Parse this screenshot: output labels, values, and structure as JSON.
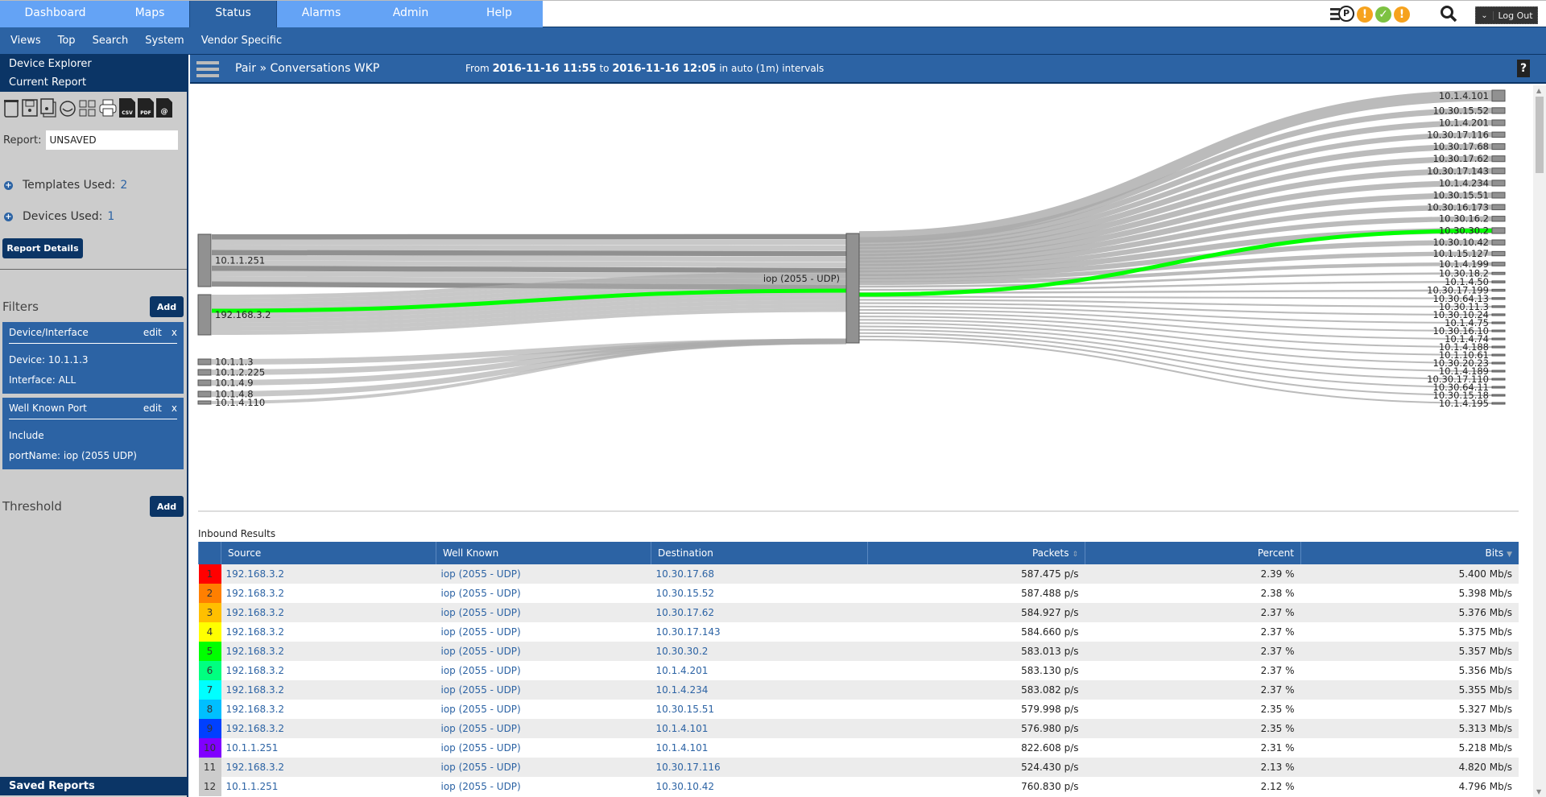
{
  "topnav": {
    "tabs": [
      {
        "label": "Dashboard",
        "active": false
      },
      {
        "label": "Maps",
        "active": false
      },
      {
        "label": "Status",
        "active": true
      },
      {
        "label": "Alarms",
        "active": false
      },
      {
        "label": "Admin",
        "active": false
      },
      {
        "label": "Help",
        "active": false
      }
    ],
    "status_icons": [
      "ep-p-icon",
      "warning-icon",
      "ok-check-icon",
      "warning-icon"
    ],
    "logout_label": "Log Out"
  },
  "subnav": {
    "items": [
      "Views",
      "Top",
      "Search",
      "System",
      "Vendor Specific"
    ]
  },
  "sidebar": {
    "device_explorer": "Device Explorer",
    "current_report": "Current Report",
    "toolbar_icons": [
      "trash-icon",
      "save-icon",
      "save-as-icon",
      "clock-icon",
      "grid-icon",
      "print-icon",
      "csv-icon",
      "pdf-icon",
      "email-icon"
    ],
    "csv": "CSV",
    "pdf": "PDF",
    "at": "@",
    "report_label": "Report:",
    "report_value": "UNSAVED",
    "templates_label": "Templates Used:",
    "templates_count": "2",
    "devices_label": "Devices Used:",
    "devices_count": "1",
    "report_details": "Report Details",
    "filters_title": "Filters",
    "add_label": "Add",
    "filters": [
      {
        "title": "Device/Interface",
        "edit": "edit",
        "remove": "x",
        "lines": [
          "Device: 10.1.1.3",
          "Interface: ALL"
        ]
      },
      {
        "title": "Well Known Port",
        "edit": "edit",
        "remove": "x",
        "lines": [
          "Include",
          "portName: iop (2055 UDP)"
        ]
      }
    ],
    "threshold_title": "Threshold",
    "saved_reports": "Saved Reports"
  },
  "header": {
    "breadcrumb": "Pair » Conversations WKP",
    "from": "From",
    "start": "2016-11-16 11:55",
    "to": "to",
    "end": "2016-11-16 12:05",
    "interval": "in auto (1m) intervals",
    "help": "?"
  },
  "chart_data": {
    "type": "sankey",
    "highlight_color": "#00ff00",
    "sources": [
      "10.1.1.251",
      "192.168.3.2",
      "10.1.1.3",
      "10.1.2.225",
      "10.1.4.9",
      "10.1.4.8",
      "10.1.4.110"
    ],
    "source_weights": [
      36,
      28,
      2,
      2,
      2,
      2,
      1
    ],
    "middle": "iop (2055 - UDP)",
    "destinations": [
      "10.1.4.101",
      "10.30.15.52",
      "10.1.4.201",
      "10.30.17.116",
      "10.30.17.68",
      "10.30.17.62",
      "10.30.17.143",
      "10.1.4.234",
      "10.30.15.51",
      "10.30.16.173",
      "10.30.16.2",
      "10.30.30.2",
      "10.30.10.42",
      "10.1.15.127",
      "10.1.4.199",
      "10.30.18.2",
      "10.1.4.50",
      "10.30.17.199",
      "10.30.64.13",
      "10.30.11.3",
      "10.30.10.24",
      "10.1.4.75",
      "10.30.16.10",
      "10.1.4.74",
      "10.1.4.188",
      "10.1.10.61",
      "10.30.20.23",
      "10.1.4.189",
      "10.30.17.110",
      "10.30.64.11",
      "10.30.15.18",
      "10.1.4.195"
    ],
    "destination_weights": [
      4.6,
      2.39,
      2.37,
      2.13,
      2.39,
      2.37,
      2.37,
      2.37,
      2.35,
      2.2,
      2.1,
      2.37,
      2.12,
      1.8,
      1.5,
      0.9,
      0.8,
      0.8,
      0.7,
      0.7,
      0.7,
      0.6,
      0.6,
      0.6,
      0.6,
      0.5,
      0.5,
      0.5,
      0.5,
      0.5,
      0.4,
      0.4
    ],
    "highlight": {
      "source": "192.168.3.2",
      "destination": "10.30.30.2"
    }
  },
  "results": {
    "title": "Inbound Results",
    "columns": [
      "",
      "Source",
      "Well Known",
      "Destination",
      "Packets",
      "Percent",
      "Bits"
    ],
    "rows": [
      {
        "n": "1",
        "color": "#ff0000",
        "source": "192.168.3.2",
        "wk": "iop (2055 - UDP)",
        "dest": "10.30.17.68",
        "packets": "587.475 p/s",
        "percent": "2.39 %",
        "bits": "5.400 Mb/s"
      },
      {
        "n": "2",
        "color": "#ff7f00",
        "source": "192.168.3.2",
        "wk": "iop (2055 - UDP)",
        "dest": "10.30.15.52",
        "packets": "587.488 p/s",
        "percent": "2.38 %",
        "bits": "5.398 Mb/s"
      },
      {
        "n": "3",
        "color": "#ffbf00",
        "source": "192.168.3.2",
        "wk": "iop (2055 - UDP)",
        "dest": "10.30.17.62",
        "packets": "584.927 p/s",
        "percent": "2.37 %",
        "bits": "5.376 Mb/s"
      },
      {
        "n": "4",
        "color": "#ffff00",
        "source": "192.168.3.2",
        "wk": "iop (2055 - UDP)",
        "dest": "10.30.17.143",
        "packets": "584.660 p/s",
        "percent": "2.37 %",
        "bits": "5.375 Mb/s"
      },
      {
        "n": "5",
        "color": "#00ff00",
        "source": "192.168.3.2",
        "wk": "iop (2055 - UDP)",
        "dest": "10.30.30.2",
        "packets": "583.013 p/s",
        "percent": "2.37 %",
        "bits": "5.357 Mb/s"
      },
      {
        "n": "6",
        "color": "#00ff80",
        "source": "192.168.3.2",
        "wk": "iop (2055 - UDP)",
        "dest": "10.1.4.201",
        "packets": "583.130 p/s",
        "percent": "2.37 %",
        "bits": "5.356 Mb/s"
      },
      {
        "n": "7",
        "color": "#00ffff",
        "source": "192.168.3.2",
        "wk": "iop (2055 - UDP)",
        "dest": "10.1.4.234",
        "packets": "583.082 p/s",
        "percent": "2.37 %",
        "bits": "5.355 Mb/s"
      },
      {
        "n": "8",
        "color": "#00bfff",
        "source": "192.168.3.2",
        "wk": "iop (2055 - UDP)",
        "dest": "10.30.15.51",
        "packets": "579.998 p/s",
        "percent": "2.35 %",
        "bits": "5.327 Mb/s"
      },
      {
        "n": "9",
        "color": "#0040ff",
        "source": "192.168.3.2",
        "wk": "iop (2055 - UDP)",
        "dest": "10.1.4.101",
        "packets": "576.980 p/s",
        "percent": "2.35 %",
        "bits": "5.313 Mb/s"
      },
      {
        "n": "10",
        "color": "#8000ff",
        "source": "10.1.1.251",
        "wk": "iop (2055 - UDP)",
        "dest": "10.1.4.101",
        "packets": "822.608 p/s",
        "percent": "2.31 %",
        "bits": "5.218 Mb/s"
      },
      {
        "n": "11",
        "color": "#cccccc",
        "source": "192.168.3.2",
        "wk": "iop (2055 - UDP)",
        "dest": "10.30.17.116",
        "packets": "524.430 p/s",
        "percent": "2.13 %",
        "bits": "4.820 Mb/s"
      },
      {
        "n": "12",
        "color": "#cccccc",
        "source": "10.1.1.251",
        "wk": "iop (2055 - UDP)",
        "dest": "10.30.10.42",
        "packets": "760.830 p/s",
        "percent": "2.12 %",
        "bits": "4.796 Mb/s"
      }
    ]
  }
}
